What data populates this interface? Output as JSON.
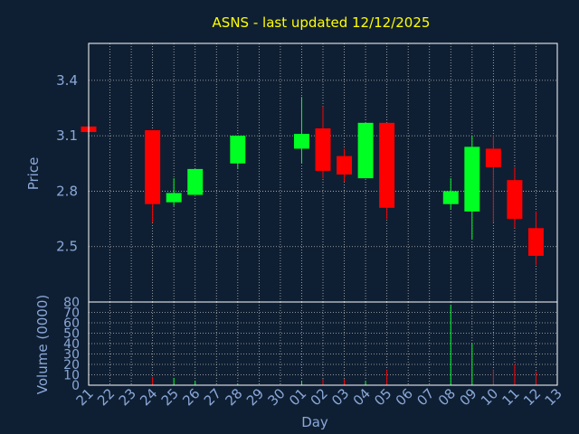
{
  "chart_data": {
    "type": "candlestick",
    "title": "ASNS - last updated 12/12/2025",
    "xlabel": "Day",
    "ylabel": "Price",
    "volume_ylabel": "Volume (0000)",
    "price_ticks": [
      "2.5",
      "2.8",
      "3.1",
      "3.4"
    ],
    "price_ylim": [
      2.2,
      3.6
    ],
    "volume_ticks": [
      "0",
      "10",
      "20",
      "30",
      "40",
      "50",
      "60",
      "70",
      "80"
    ],
    "volume_ylim": [
      0,
      80
    ],
    "grid": true,
    "colors": {
      "background": "#0f1f33",
      "up": "#00ff22",
      "down": "#ff0000",
      "title": "#ffff00",
      "axis_text": "#8aa8d8",
      "frame": "#ffffff",
      "grid": "#b8b8b8"
    },
    "days": [
      "21",
      "22",
      "23",
      "24",
      "25",
      "26",
      "27",
      "28",
      "29",
      "30",
      "01",
      "02",
      "03",
      "04",
      "05",
      "06",
      "07",
      "08",
      "09",
      "10",
      "11",
      "12",
      "13"
    ],
    "candles": [
      {
        "day": "21",
        "open": 3.15,
        "close": 3.12,
        "high": 3.15,
        "low": 3.12,
        "volume": 0
      },
      {
        "day": "24",
        "open": 3.13,
        "close": 2.73,
        "high": 3.13,
        "low": 2.63,
        "volume": 8
      },
      {
        "day": "25",
        "open": 2.74,
        "close": 2.79,
        "high": 2.87,
        "low": 2.72,
        "volume": 7
      },
      {
        "day": "26",
        "open": 2.78,
        "close": 2.92,
        "high": 2.92,
        "low": 2.78,
        "volume": 4
      },
      {
        "day": "28",
        "open": 2.95,
        "close": 3.1,
        "high": 3.1,
        "low": 2.92,
        "volume": 1
      },
      {
        "day": "01",
        "open": 3.03,
        "close": 3.11,
        "high": 3.31,
        "low": 2.95,
        "volume": 4
      },
      {
        "day": "02",
        "open": 3.14,
        "close": 2.91,
        "high": 3.26,
        "low": 2.87,
        "volume": 6
      },
      {
        "day": "03",
        "open": 2.99,
        "close": 2.89,
        "high": 3.03,
        "low": 2.85,
        "volume": 6
      },
      {
        "day": "04",
        "open": 2.87,
        "close": 3.17,
        "high": 3.17,
        "low": 2.87,
        "volume": 4
      },
      {
        "day": "05",
        "open": 3.17,
        "close": 2.71,
        "high": 3.17,
        "low": 2.65,
        "volume": 15
      },
      {
        "day": "08",
        "open": 2.73,
        "close": 2.8,
        "high": 2.87,
        "low": 2.7,
        "volume": 77
      },
      {
        "day": "09",
        "open": 2.69,
        "close": 3.04,
        "high": 3.1,
        "low": 2.54,
        "volume": 40
      },
      {
        "day": "10",
        "open": 3.03,
        "close": 2.93,
        "high": 3.1,
        "low": 2.63,
        "volume": 15
      },
      {
        "day": "11",
        "open": 2.86,
        "close": 2.65,
        "high": 2.93,
        "low": 2.6,
        "volume": 20
      },
      {
        "day": "12",
        "open": 2.6,
        "close": 2.45,
        "high": 2.69,
        "low": 2.4,
        "volume": 13
      }
    ]
  }
}
